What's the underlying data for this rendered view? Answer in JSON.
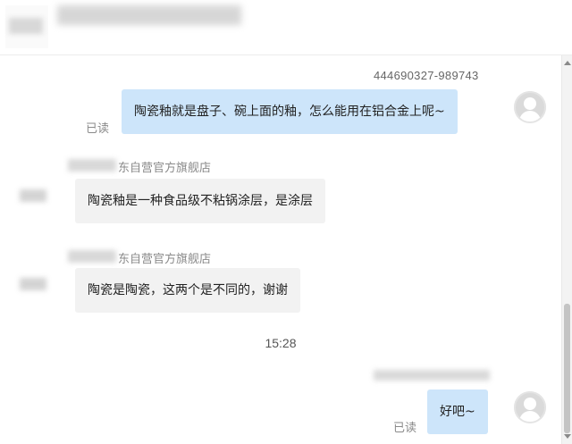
{
  "conversation": {
    "user_id": "444690327-989743",
    "read_label": "已读",
    "time_divider": "15:28",
    "messages": [
      {
        "text": "陶瓷釉就是盘子、碗上面的釉，怎么能用在铝合金上呢~"
      },
      {
        "sender": "东自营官方旗舰店",
        "text": "陶瓷釉是一种食品级不粘锅涂层，是涂层"
      },
      {
        "sender": "东自营官方旗舰店",
        "text": "陶瓷是陶瓷，这两个是不同的，谢谢"
      },
      {
        "text": "好吧~"
      }
    ]
  },
  "icons": {
    "user_avatar": "user-avatar-icon",
    "scroll_up": "chevron-up-icon",
    "scroll_down": "chevron-down-icon"
  },
  "colors": {
    "outgoing_bubble": "#cde5fa",
    "incoming_bubble": "#f2f2f2",
    "read_text": "#8a8a8a"
  }
}
